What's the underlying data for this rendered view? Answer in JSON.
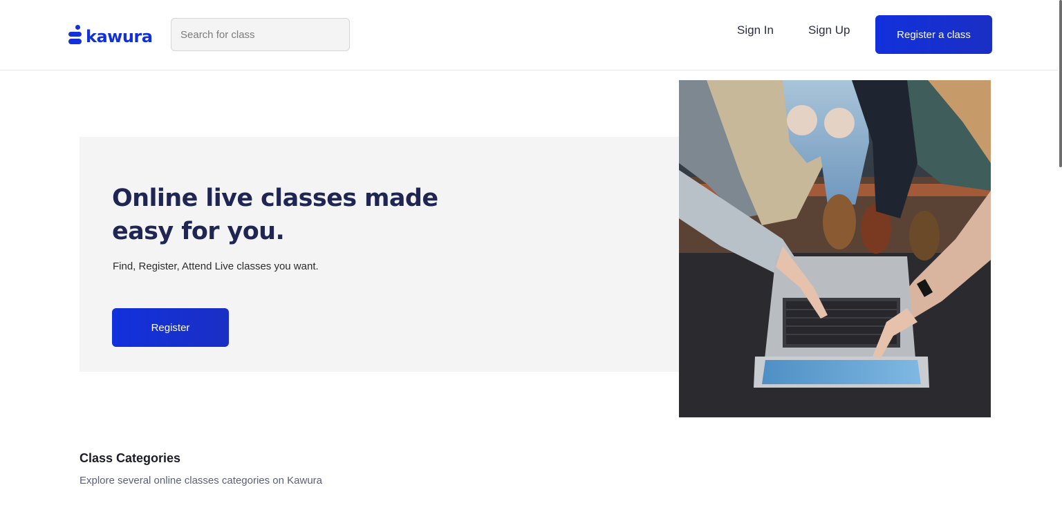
{
  "header": {
    "logo_text": "kawura",
    "search": {
      "placeholder": "Search for class",
      "value": ""
    },
    "nav": {
      "sign_in": "Sign In",
      "sign_up": "Sign Up",
      "register_class": "Register a class"
    }
  },
  "hero": {
    "title": "Online live classes made easy for you.",
    "subtitle": "Find, Register, Attend Live classes you want.",
    "register_button": "Register"
  },
  "categories": {
    "title": "Class Categories",
    "subtitle": "Explore several online classes categories on Kawura"
  },
  "colors": {
    "brand": "#1230dc",
    "heading": "#1f2653",
    "panel": "#f4f4f4"
  }
}
